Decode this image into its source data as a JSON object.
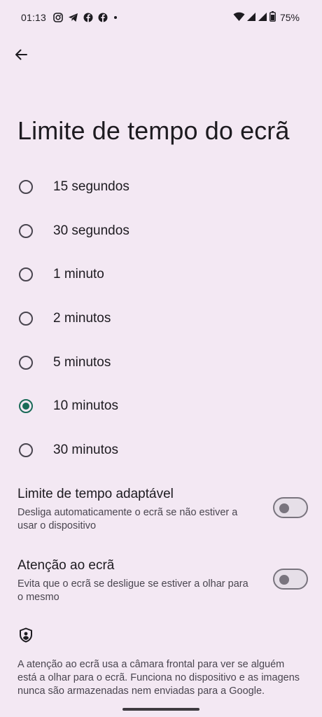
{
  "status_bar": {
    "time": "01:13",
    "battery": "75%"
  },
  "page": {
    "title": "Limite de tempo do ecrã"
  },
  "options": [
    {
      "label": "15 segundos",
      "checked": false
    },
    {
      "label": "30 segundos",
      "checked": false
    },
    {
      "label": "1 minuto",
      "checked": false
    },
    {
      "label": "2 minutos",
      "checked": false
    },
    {
      "label": "5 minutos",
      "checked": false
    },
    {
      "label": "10 minutos",
      "checked": true
    },
    {
      "label": "30 minutos",
      "checked": false
    }
  ],
  "adaptive": {
    "title": "Limite de tempo adaptável",
    "description": "Desliga automaticamente o ecrã se não estiver a usar o dispositivo",
    "enabled": false
  },
  "attention": {
    "title": "Atenção ao ecrã",
    "description": "Evita que o ecrã se desligue se estiver a olhar para o mesmo",
    "enabled": false
  },
  "info": {
    "text": "A atenção ao ecrã usa a câmara frontal para ver se alguém está a olhar para o ecrã. Funciona no dispositivo e as imagens nunca são armazenadas nem enviadas para a Google."
  },
  "colors": {
    "accent": "#1a6b58",
    "background": "#f3e8f3"
  }
}
